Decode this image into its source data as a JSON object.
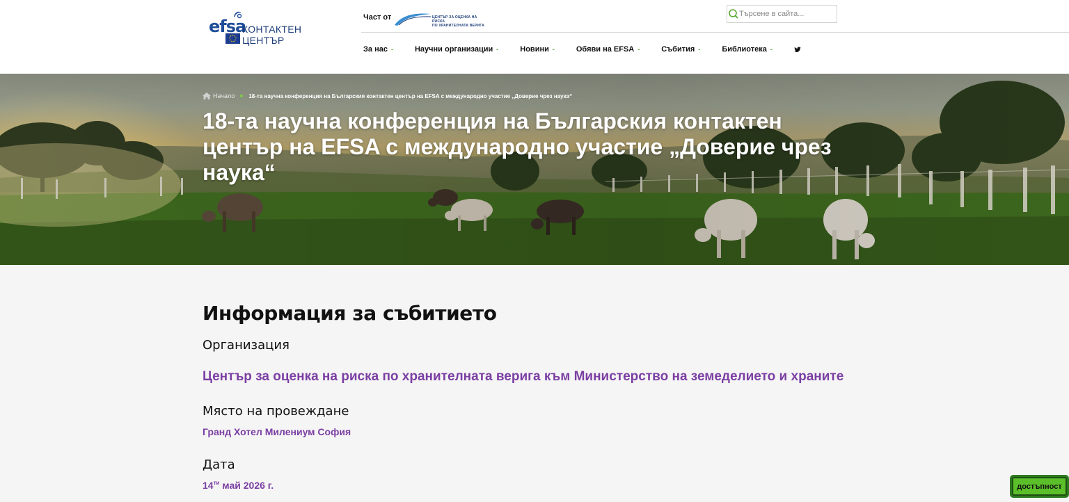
{
  "header": {
    "logo_mark": "efsa",
    "logo_text": "КОНТАКТЕН ЦЕНТЪР",
    "part_of_label": "Част от",
    "partner_logo_line1": "ЦЕНТЪР ЗА ОЦЕНКА НА РИСКА",
    "partner_logo_line2": "ПО ХРАНИТЕЛНАТА ВЕРИГА",
    "search_placeholder": "Търсене в сайта...",
    "nav": [
      {
        "label": "За нас"
      },
      {
        "label": "Научни организации"
      },
      {
        "label": "Новини"
      },
      {
        "label": "Обяви на EFSA"
      },
      {
        "label": "Събития"
      },
      {
        "label": "Библиотека"
      }
    ],
    "twitter_icon": "twitter-icon",
    "accent_color": "#5aaa32"
  },
  "hero": {
    "breadcrumb_home": "Начало",
    "breadcrumb_current": "18-та научна конференция на Българския контактен център на EFSA с международно участие „Доверие чрез наука“",
    "title": "18-та научна конференция на Българския контактен център на EFSA с международно участие „Доверие чрез наука“"
  },
  "event": {
    "heading": "Информация за събитието",
    "organization_label": "Организация",
    "organization_value": "Център за оценка на риска по хранителната верига към Министерство на земеделието и храните",
    "venue_label": "Място на провеждане",
    "venue_value": "Гранд Хотел Милениум София",
    "date_label": "Дата",
    "date_day": "14",
    "date_suffix": "ти",
    "date_rest": " май 2026 г.",
    "link_color": "#7b3fa3"
  },
  "accessibility_button": "достъпност"
}
